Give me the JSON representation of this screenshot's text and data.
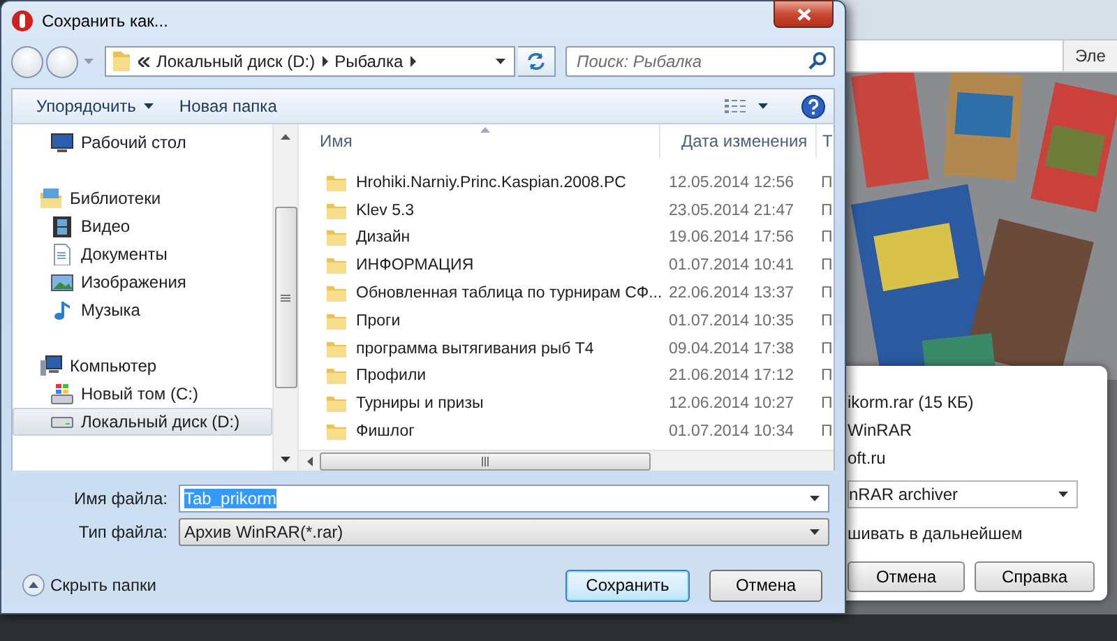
{
  "dialog": {
    "title": "Сохранить как...",
    "address": {
      "crumbs": [
        "Локальный диск (D:)",
        "Рыбалка"
      ]
    },
    "search": {
      "placeholder": "Поиск: Рыбалка"
    },
    "toolbar": {
      "organize": "Упорядочить",
      "new_folder": "Новая папка"
    },
    "sidebar": {
      "sections": [
        {
          "children": [
            {
              "label": "Рабочий стол",
              "kind": "desktop",
              "selected": false
            }
          ]
        },
        {
          "label": "Библиотеки",
          "kind": "library",
          "selected": false,
          "children": [
            {
              "label": "Видео",
              "kind": "video",
              "selected": false
            },
            {
              "label": "Документы",
              "kind": "documents",
              "selected": false
            },
            {
              "label": "Изображения",
              "kind": "pictures",
              "selected": false
            },
            {
              "label": "Музыка",
              "kind": "music",
              "selected": false
            }
          ]
        },
        {
          "label": "Компьютер",
          "kind": "computer",
          "selected": false,
          "children": [
            {
              "label": "Новый том (C:)",
              "kind": "system-drive",
              "selected": false
            },
            {
              "label": "Локальный диск (D:)",
              "kind": "drive",
              "selected": true
            }
          ]
        }
      ]
    },
    "files": {
      "columns": [
        "Имя",
        "Дата изменения",
        "Т"
      ],
      "rows": [
        {
          "name": "Hrohiki.Narniy.Princ.Kaspian.2008.PC",
          "date": "12.05.2014 12:56",
          "column_3": "П"
        },
        {
          "name": "Klev 5.3",
          "date": "23.05.2014 21:47",
          "column_3": "П"
        },
        {
          "name": "Дизайн",
          "date": "19.06.2014 17:56",
          "column_3": "П"
        },
        {
          "name": "ИНФОРМАЦИЯ",
          "date": "01.07.2014 10:41",
          "column_3": "П"
        },
        {
          "name": "Обновленная таблица по турнирам СФ...",
          "date": "22.06.2014 13:37",
          "column_3": "П"
        },
        {
          "name": "Проги",
          "date": "01.07.2014 10:35",
          "column_3": "П"
        },
        {
          "name": "программа вытягивания рыб Т4",
          "date": "09.04.2014 17:38",
          "column_3": "П"
        },
        {
          "name": "Профили",
          "date": "21.06.2014 17:12",
          "column_3": "П"
        },
        {
          "name": "Турниры и призы",
          "date": "12.06.2014 10:27",
          "column_3": "П"
        },
        {
          "name": "Фишлог",
          "date": "01.07.2014 10:34",
          "column_3": "П"
        }
      ]
    },
    "file_name": {
      "label": "Имя файла:",
      "value": "Tab_prikorm",
      "text_selected": true
    },
    "file_type": {
      "label": "Тип файла:",
      "value": "Архив WinRAR(*.rar)"
    },
    "hide_folders": "Скрыть папки",
    "buttons": [
      {
        "label": "Сохранить",
        "default": true
      },
      {
        "label": "Отмена",
        "default": false
      }
    ]
  },
  "background_window": {
    "tab": "Эле",
    "popup": {
      "lines": [
        "ikorm.rar (15 КБ)",
        "WinRAR",
        "oft.ru"
      ],
      "select": "nRAR archiver",
      "option_text": "шивать в дальнейшем",
      "buttons": [
        "Отмена",
        "Справка"
      ]
    }
  }
}
